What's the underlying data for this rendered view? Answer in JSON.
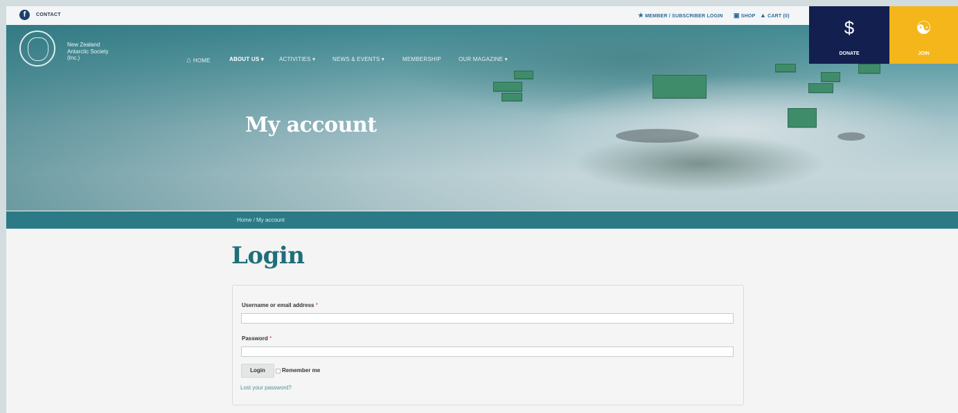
{
  "topbar": {
    "facebook_icon": "f",
    "contact_label": "CONTACT",
    "member_login_label": "MEMBER / SUBSCRIBER LOGIN",
    "shop_label": "SHOP",
    "cart_label": "CART (0)"
  },
  "header": {
    "logo_text": "New Zealand Antarctic Society (Inc.)",
    "nav": [
      {
        "label": "HOME"
      },
      {
        "label": "ABOUT US ▾"
      },
      {
        "label": "ACTIVITIES ▾"
      },
      {
        "label": "NEWS & EVENTS ▾"
      },
      {
        "label": "MEMBERSHIP"
      },
      {
        "label": "OUR MAGAZINE ▾"
      }
    ],
    "donate_label": "DONATE",
    "join_label": "JOIN"
  },
  "hero": {
    "title": "My account",
    "breadcrumb": "Home / My account"
  },
  "login": {
    "title": "Login",
    "username_label": "Username or email address",
    "password_label": "Password",
    "required_mark": "*",
    "username_value": "",
    "password_value": "",
    "button_label": "Login",
    "remember_label": "Remember me",
    "lost_password_label": "Lost your password?"
  },
  "colors": {
    "accent_teal": "#1f6e7a",
    "donate_navy": "#131f4e",
    "join_yellow": "#f4b61a",
    "breadcrumb_bar": "#2b7a86"
  }
}
